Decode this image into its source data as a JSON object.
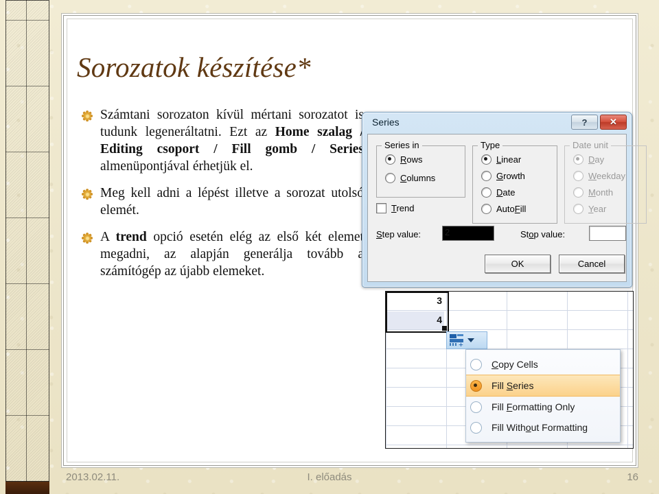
{
  "slide": {
    "title": "Sorozatok készítése*",
    "title_color": "#603913",
    "background_color": "#efe8cd"
  },
  "bullets": [
    {
      "id": "bullet-1",
      "segments": [
        {
          "text": "Számtani sorozaton kívül mértani sorozatot is tudunk legeneráltatni. Ezt az ",
          "bold": false
        },
        {
          "text": "Home szalag / Editing csoport / Fill gomb / Series",
          "bold": true
        },
        {
          "text": " almenüpontjával érhetjük el.",
          "bold": false
        }
      ]
    },
    {
      "id": "bullet-2",
      "segments": [
        {
          "text": "Meg kell adni a lépést illetve a sorozat utolsó elemét.",
          "bold": false
        }
      ]
    },
    {
      "id": "bullet-3",
      "segments": [
        {
          "text": "A ",
          "bold": false
        },
        {
          "text": "trend",
          "bold": true
        },
        {
          "text": " opció esetén elég az első két elemet megadni, az alapján generálja tovább a számítógép az újabb elemeket.",
          "bold": false
        }
      ]
    }
  ],
  "dialog": {
    "title": "Series",
    "help_button": "?",
    "close_button": "✕",
    "series_in": {
      "legend": "Series in",
      "options": [
        {
          "label": "Rows",
          "accel": "R",
          "selected": true
        },
        {
          "label": "Columns",
          "accel": "C",
          "selected": false
        }
      ]
    },
    "type": {
      "legend": "Type",
      "options": [
        {
          "label": "Linear",
          "accel": "L",
          "selected": true
        },
        {
          "label": "Growth",
          "accel": "G",
          "selected": false
        },
        {
          "label": "Date",
          "accel": "D",
          "selected": false
        },
        {
          "label": "AutoFill",
          "accel": "F",
          "selected": false
        }
      ]
    },
    "date_unit": {
      "legend": "Date unit",
      "disabled": true,
      "options": [
        {
          "label": "Day",
          "accel": "D",
          "selected": true
        },
        {
          "label": "Weekday",
          "accel": "W",
          "selected": false
        },
        {
          "label": "Month",
          "accel": "M",
          "selected": false
        },
        {
          "label": "Year",
          "accel": "Y",
          "selected": false
        }
      ]
    },
    "trend": {
      "label": "Trend",
      "accel": "T",
      "checked": false
    },
    "step_value": {
      "label": "Step value:",
      "accel": "S",
      "value": "2",
      "selected": true
    },
    "stop_value": {
      "label": "Stop value:",
      "accel": "o",
      "value": ""
    },
    "ok_button": "OK",
    "cancel_button": "Cancel"
  },
  "sheet": {
    "cells": [
      {
        "value": "3",
        "highlighted": false
      },
      {
        "value": "4",
        "highlighted": true
      }
    ],
    "smart_tag_icon": "autofill-options-icon",
    "fill_menu": [
      {
        "label": "Copy Cells",
        "accel": "C",
        "selected": false
      },
      {
        "label": "Fill Series",
        "accel": "S",
        "selected": true
      },
      {
        "label": "Fill Formatting Only",
        "accel": "F",
        "selected": false
      },
      {
        "label": "Fill Without Formatting",
        "accel": "o",
        "selected": false
      }
    ],
    "selection_accent": "#f19321"
  },
  "footer": {
    "date": "2013.02.11.",
    "center": "I. előadás",
    "page": "16"
  }
}
